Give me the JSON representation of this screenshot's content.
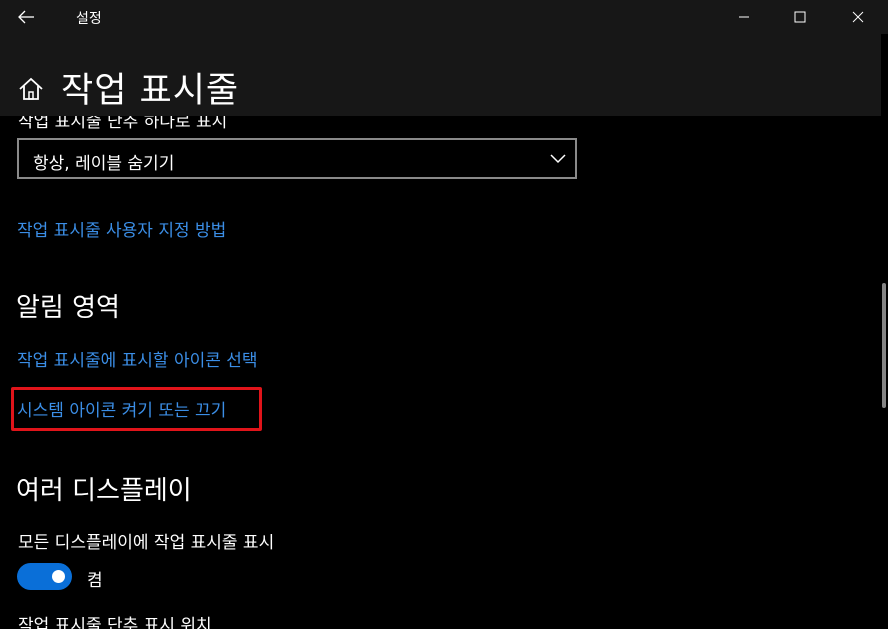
{
  "window": {
    "app_title": "설정"
  },
  "header": {
    "page_title": "작업 표시줄"
  },
  "content": {
    "partial_label_top": "작업 표시줄 단추 하나로 표시",
    "dropdown": {
      "selected": "항상, 레이블 숨기기"
    },
    "link_customize": "작업 표시줄 사용자 지정 방법",
    "section_notification": {
      "heading": "알림 영역",
      "link_select_icons": "작업 표시줄에 표시할 아이콘 선택",
      "link_system_icons": "시스템 아이콘 켜기 또는 끄기"
    },
    "section_multi_display": {
      "heading": "여러 디스플레이",
      "setting_label": "모든 디스플레이에 작업 표시줄 표시",
      "toggle_state": "켬",
      "toggle_on": true,
      "partial_label_bottom": "작업 표시줄 단추 표시 위치"
    }
  },
  "colors": {
    "link": "#3b8ee6",
    "toggle_on": "#0a6fd8",
    "highlight": "#e0141a",
    "titlebar_bg": "#171717"
  },
  "icons": {
    "back": "back-arrow-icon",
    "minimize": "minimize-icon",
    "maximize": "maximize-icon",
    "close": "close-icon",
    "home": "home-icon",
    "dropdown": "chevron-down-icon"
  }
}
